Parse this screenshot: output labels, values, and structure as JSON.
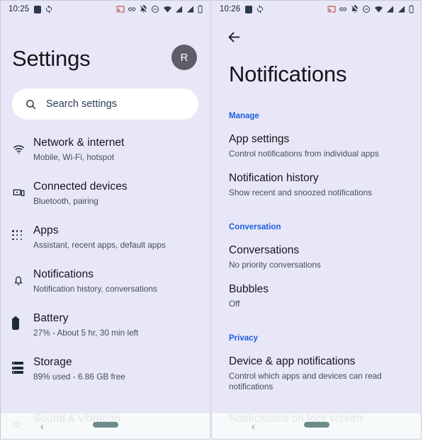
{
  "left": {
    "status": {
      "time": "10:25",
      "left_icons": [
        "square-icon",
        "sync-icon"
      ],
      "right_icons": [
        "cast-icon",
        "link-icon",
        "notifications-off-icon",
        "do-not-disturb-icon",
        "wifi-icon",
        "signal-icon",
        "signal-2-icon",
        "battery-icon"
      ]
    },
    "avatar_initial": "R",
    "title": "Settings",
    "search": {
      "placeholder": "Search settings",
      "icon": "search-icon"
    },
    "items": [
      {
        "icon": "wifi-icon",
        "title": "Network & internet",
        "sub": "Mobile, Wi-Fi, hotspot"
      },
      {
        "icon": "connected-devices-icon",
        "title": "Connected devices",
        "sub": "Bluetooth, pairing"
      },
      {
        "icon": "apps-grid-icon",
        "title": "Apps",
        "sub": "Assistant, recent apps, default apps"
      },
      {
        "icon": "bell-icon",
        "title": "Notifications",
        "sub": "Notification history, conversations"
      },
      {
        "icon": "battery-icon",
        "title": "Battery",
        "sub": "27% - About 5 hr, 30 min left"
      },
      {
        "icon": "storage-icon",
        "title": "Storage",
        "sub": "89% used - 6.86 GB free"
      }
    ],
    "peek_item": {
      "icon": "volume-icon",
      "title": "Sound & vibration"
    },
    "navbar": {
      "back": "‹",
      "pill": "home-pill"
    }
  },
  "right": {
    "status": {
      "time": "10:26",
      "left_icons": [
        "square-icon",
        "sync-icon"
      ],
      "right_icons": [
        "cast-icon",
        "link-icon",
        "notifications-off-icon",
        "do-not-disturb-icon",
        "wifi-icon",
        "signal-icon",
        "signal-2-icon",
        "battery-icon"
      ]
    },
    "back_icon": "back-arrow-icon",
    "title": "Notifications",
    "sections": [
      {
        "label": "Manage",
        "items": [
          {
            "title": "App settings",
            "sub": "Control notifications from individual apps"
          },
          {
            "title": "Notification history",
            "sub": "Show recent and snoozed notifications"
          }
        ]
      },
      {
        "label": "Conversation",
        "items": [
          {
            "title": "Conversations",
            "sub": "No priority conversations"
          },
          {
            "title": "Bubbles",
            "sub": "Off"
          }
        ]
      },
      {
        "label": "Privacy",
        "items": [
          {
            "title": "Device & app notifications",
            "sub": "Control which apps and devices can read notifications"
          }
        ]
      }
    ],
    "peek_item": {
      "icon": "lock-screen-icon",
      "title": "Notifications on lock screen"
    },
    "navbar": {
      "back": "‹",
      "pill": "home-pill"
    }
  },
  "colors": {
    "background": "#e8e7f7",
    "accent_blue": "#1a5fe0",
    "title": "#14161c",
    "subtitle": "#454d5c",
    "avatar_bg": "#605d69",
    "navbar_accent": "#6b8c88"
  }
}
